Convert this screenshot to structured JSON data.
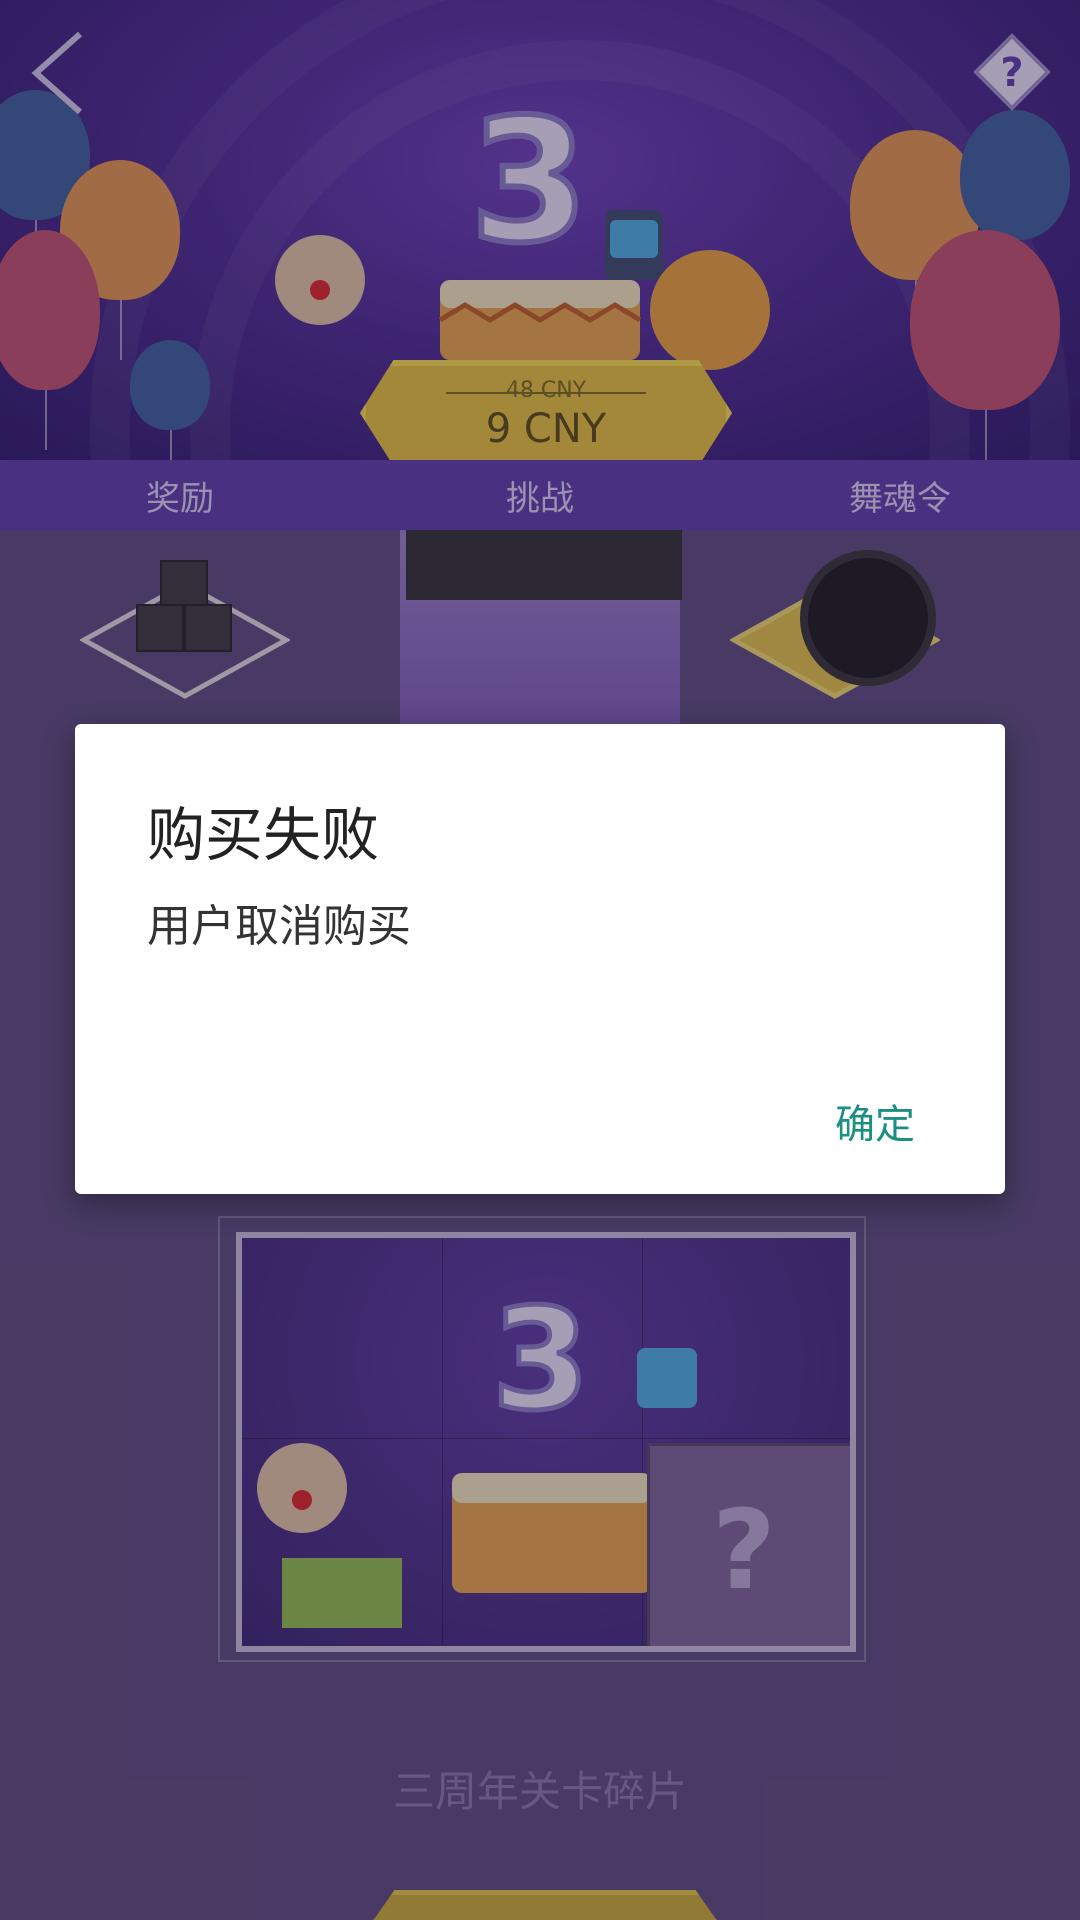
{
  "banner": {
    "old_price": "48 CNY",
    "new_price": "9 CNY"
  },
  "tabs": [
    {
      "label": "奖励"
    },
    {
      "label": "挑战"
    },
    {
      "label": "舞魂令"
    }
  ],
  "puzzle": {
    "title": "三周年关卡碎片",
    "missing_piece_symbol": "?"
  },
  "dialog": {
    "title": "购买失败",
    "message": "用户取消购买",
    "ok_label": "确定"
  },
  "colors": {
    "accent": "#1d8f82",
    "tab_bar": "#5b3ba6",
    "price_tag": "#e4c236"
  }
}
